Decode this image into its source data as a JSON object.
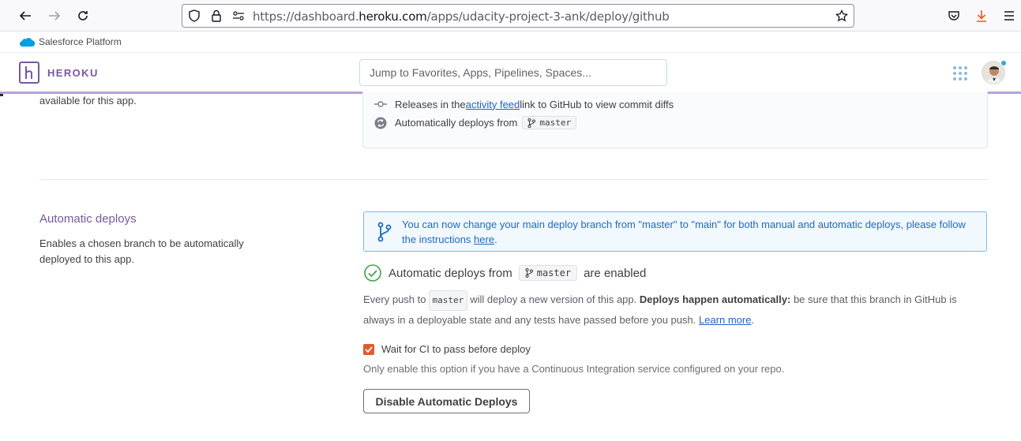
{
  "browser": {
    "url_prefix": "https://dashboard.",
    "url_host": "heroku.com",
    "url_path": "/apps/udacity-project-3-ank/deploy/github",
    "icons": [
      "back-arrow-icon",
      "forward-arrow-icon",
      "reload-icon",
      "shield-icon",
      "lock-icon",
      "permissions-icon",
      "star-icon",
      "pocket-icon",
      "download-icon",
      "menu-icon"
    ]
  },
  "salesforce_bar": {
    "label": "Salesforce Platform"
  },
  "header": {
    "brand": "HEROKU",
    "search_placeholder": "Jump to Favorites, Apps, Pipelines, Spaces...",
    "accent_color": "#79589f"
  },
  "previous_section": {
    "desc_tail": "available for this app.",
    "releases_prefix": "Releases in the ",
    "releases_link": "activity feed",
    "releases_suffix": " link to GitHub to view commit diffs",
    "auto_deploys_prefix": "Automatically deploys from",
    "branch": "master"
  },
  "automatic_deploys": {
    "title": "Automatic deploys",
    "description": "Enables a chosen branch to be automatically deployed to this app.",
    "notice_text": "You can now change your main deploy branch from \"master\" to \"main\" for both manual and automatic deploys, please follow the instructions ",
    "notice_link": "here",
    "notice_end": ".",
    "status_prefix": "Automatic deploys from",
    "status_branch": "master",
    "status_suffix": "are enabled",
    "explain_1": "Every push to",
    "explain_branch": "master",
    "explain_2": "will deploy a new version of this app.",
    "explain_bold": "Deploys happen automatically:",
    "explain_3": "be sure that this branch in GitHub is always in a deployable state and any tests have passed before you push.",
    "explain_link": "Learn more",
    "explain_end": ".",
    "ci_label": "Wait for CI to pass before deploy",
    "ci_checked": true,
    "ci_help": "Only enable this option if you have a Continuous Integration service configured on your repo.",
    "disable_button": "Disable Automatic Deploys"
  }
}
